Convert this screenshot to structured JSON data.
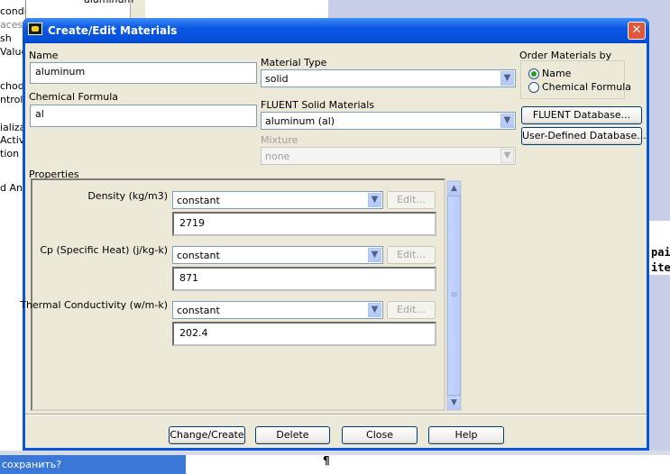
{
  "background": {
    "left_items": [
      "conditions",
      "aces",
      "sh",
      "Values",
      "chods",
      "ntrols",
      "ializa",
      "Activi",
      "tion",
      "d Ani"
    ],
    "top_item": "aluminum",
    "right_lines": [
      "pai",
      "ite"
    ],
    "taskbar_item": "сохранить?",
    "pilcrow": "¶"
  },
  "dialog": {
    "title": "Create/Edit Materials",
    "close_glyph": "✕",
    "name_label": "Name",
    "name_value": "aluminum",
    "formula_label": "Chemical Formula",
    "formula_value": "al",
    "material_type_label": "Material Type",
    "material_type_value": "solid",
    "fluent_solid_label": "FLUENT Solid Materials",
    "fluent_solid_value": "aluminum (al)",
    "mixture_label": "Mixture",
    "mixture_value": "none",
    "order_label": "Order Materials by",
    "order_options": [
      {
        "label": "Name",
        "selected": true
      },
      {
        "label": "Chemical Formula",
        "selected": false
      }
    ],
    "fluent_db_button": "FLUENT Database...",
    "user_db_button": "User-Defined Database...",
    "properties_label": "Properties",
    "properties": [
      {
        "label": "Density (kg/m3)",
        "method": "constant",
        "edit": "Edit...",
        "value": "2719"
      },
      {
        "label": "Cp (Specific Heat) (j/kg-k)",
        "method": "constant",
        "edit": "Edit...",
        "value": "871"
      },
      {
        "label": "Thermal Conductivity (w/m-k)",
        "method": "constant",
        "edit": "Edit...",
        "value": "202.4"
      }
    ],
    "buttons": {
      "change_create": "Change/Create",
      "delete": "Delete",
      "close": "Close",
      "help": "Help"
    },
    "icons": {
      "dropdown": "chevron-down-icon",
      "scroll_up": "chevron-up-icon",
      "scroll_down": "chevron-down-icon",
      "close": "close-icon"
    }
  }
}
